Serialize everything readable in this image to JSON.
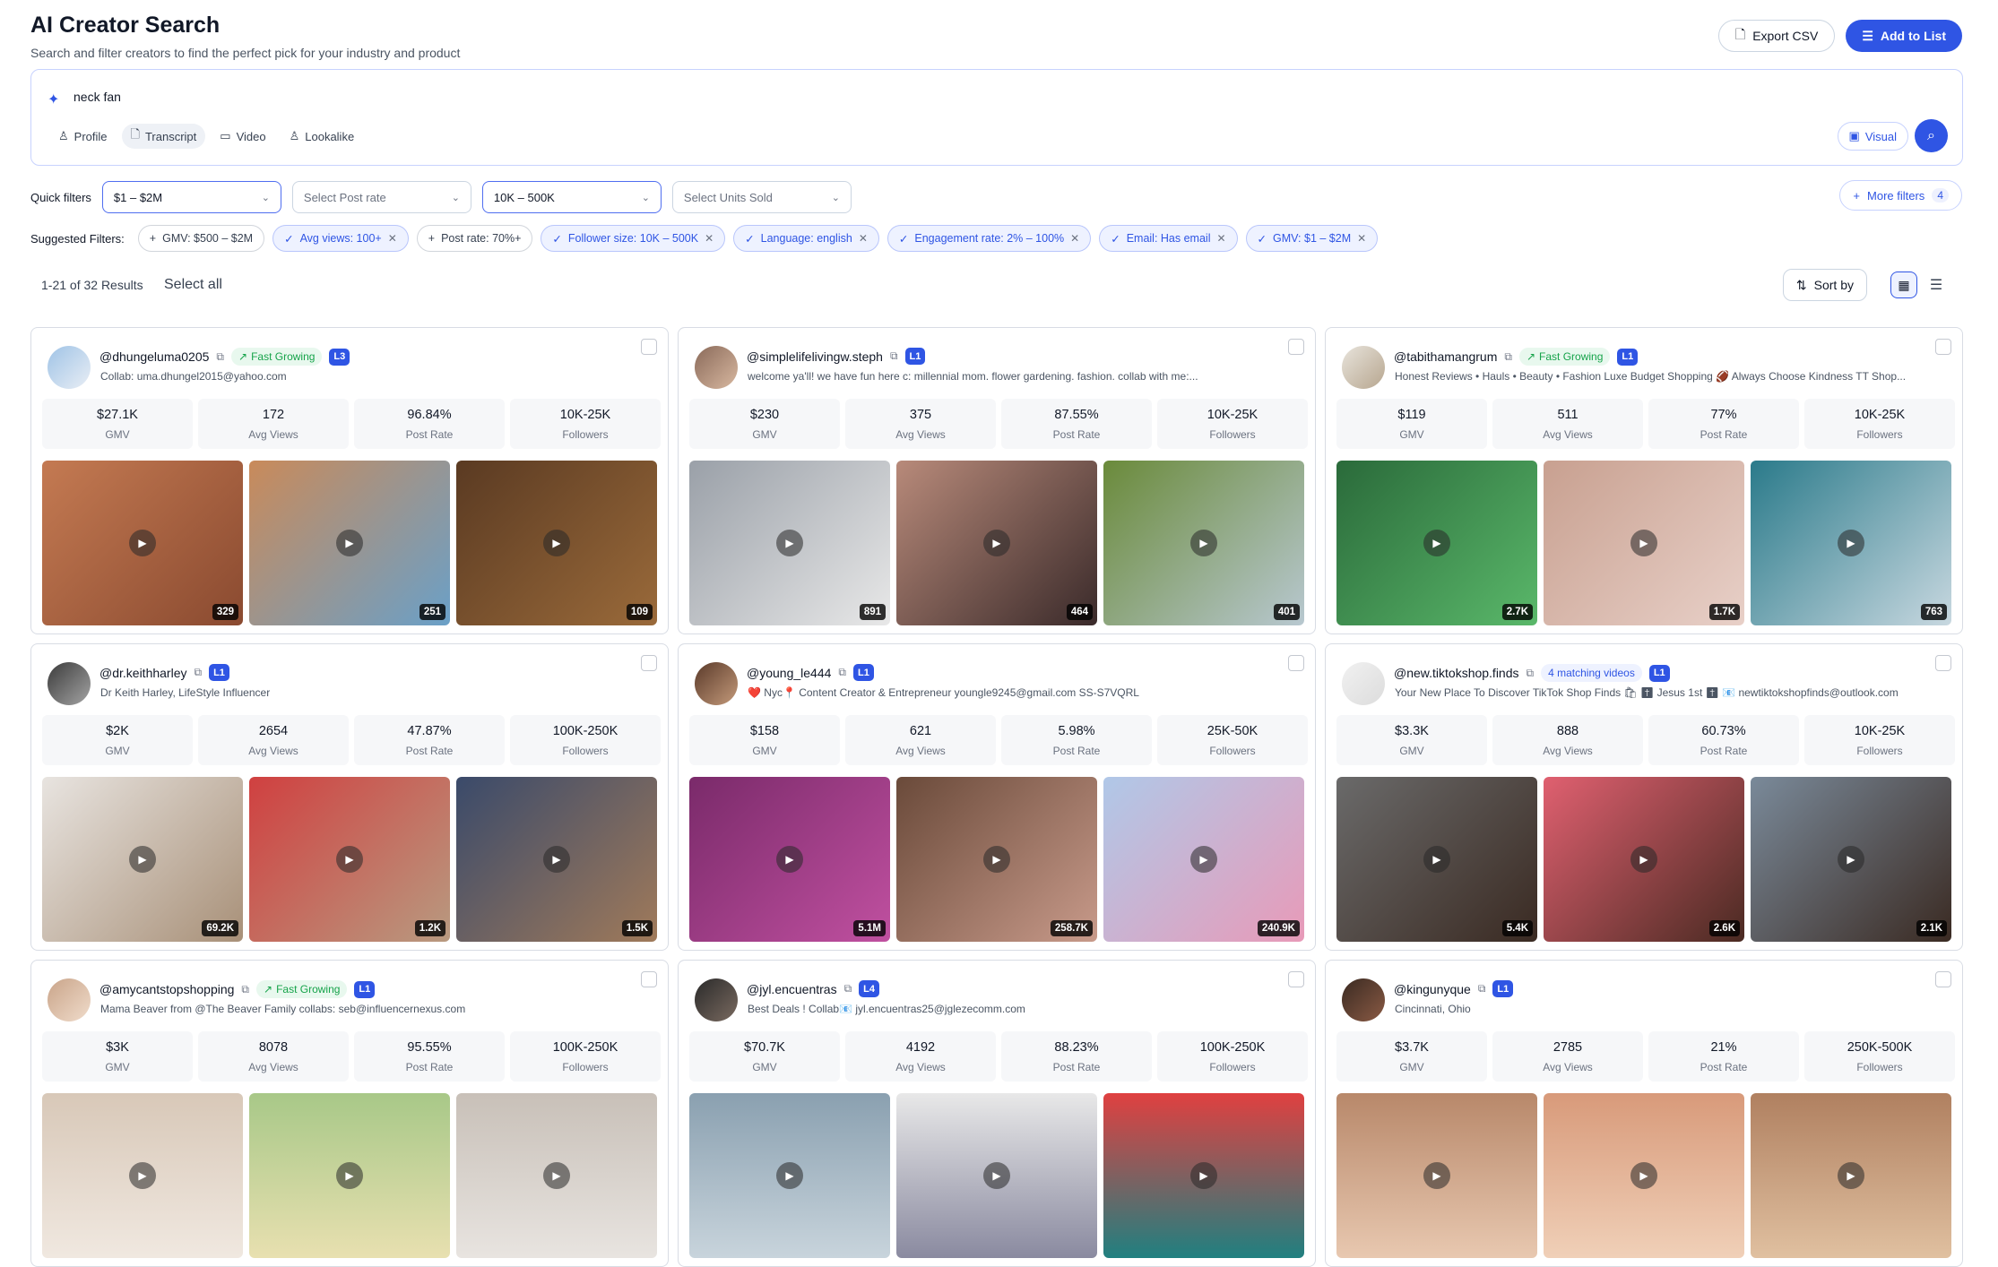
{
  "header": {
    "title": "AI Creator Search",
    "subtitle": "Search and filter creators to find the perfect pick for your industry and product",
    "export_label": "Export CSV",
    "add_label": "Add to List"
  },
  "search": {
    "query": "neck fan",
    "tabs": [
      "Profile",
      "Transcript",
      "Video",
      "Lookalike"
    ],
    "active_tab": "Transcript",
    "visual_label": "Visual"
  },
  "quick_filters": {
    "label": "Quick filters",
    "selects": [
      "$1 – $2M",
      "Select Post rate",
      "10K – 500K",
      "Select Units Sold"
    ],
    "more_label": "More filters",
    "more_count": "4"
  },
  "suggested": {
    "label": "Suggested Filters:",
    "chips": [
      "GMV: $500 – $2M",
      "Avg views: 100+",
      "Post rate: 70%+",
      "Follower size: 10K – 500K",
      "Language: english",
      "Engagement rate: 2% – 100%",
      "Email: Has email",
      "GMV: $1 – $2M"
    ]
  },
  "results": {
    "count_text": "1-21 of 32 Results",
    "select_all": "Select all",
    "sort_label": "Sort by"
  },
  "stat_labels": {
    "gmv": "GMV",
    "views": "Avg Views",
    "post": "Post Rate",
    "followers": "Followers"
  },
  "creators": [
    {
      "handle": "@dhungeluma0205",
      "badge": "Fast Growing",
      "level": "L3",
      "bio": "Collab: uma.dhungel2015@yahoo.com",
      "gmv": "$27.1K",
      "views": "172",
      "post": "96.84%",
      "followers": "10K-25K",
      "videos": [
        "329",
        "251",
        "109"
      ]
    },
    {
      "handle": "@simplelifelivingw.steph",
      "badge": "",
      "level": "L1",
      "bio": "welcome ya'll! we have fun here c: millennial mom. flower gardening. fashion. collab with me:...",
      "gmv": "$230",
      "views": "375",
      "post": "87.55%",
      "followers": "10K-25K",
      "videos": [
        "891",
        "464",
        "401"
      ]
    },
    {
      "handle": "@tabithamangrum",
      "badge": "Fast Growing",
      "level": "L1",
      "bio": "Honest Reviews • Hauls • Beauty • Fashion Luxe Budget Shopping 🏈 Always Choose Kindness TT Shop...",
      "gmv": "$119",
      "views": "511",
      "post": "77%",
      "followers": "10K-25K",
      "videos": [
        "2.7K",
        "1.7K",
        "763"
      ]
    },
    {
      "handle": "@dr.keithharley",
      "badge": "",
      "level": "L1",
      "bio": "Dr Keith Harley, LifeStyle Influencer",
      "gmv": "$2K",
      "views": "2654",
      "post": "47.87%",
      "followers": "100K-250K",
      "videos": [
        "69.2K",
        "1.2K",
        "1.5K"
      ]
    },
    {
      "handle": "@young_le444",
      "badge": "",
      "level": "L1",
      "bio": "❤️ Nyc📍 Content Creator & Entrepreneur youngle9245@gmail.com SS-S7VQRL",
      "gmv": "$158",
      "views": "621",
      "post": "5.98%",
      "followers": "25K-50K",
      "videos": [
        "5.1M",
        "258.7K",
        "240.9K"
      ]
    },
    {
      "handle": "@new.tiktokshop.finds",
      "badge": "4 matching videos",
      "level": "L1",
      "bio": "Your New Place To Discover TikTok Shop Finds 🛍 ✝ Jesus 1st ✝ 📧 newtiktokshopfinds@outlook.com",
      "gmv": "$3.3K",
      "views": "888",
      "post": "60.73%",
      "followers": "10K-25K",
      "videos": [
        "5.4K",
        "2.6K",
        "2.1K"
      ]
    },
    {
      "handle": "@amycantstopshopping",
      "badge": "Fast Growing",
      "level": "L1",
      "bio": "Mama Beaver from @The Beaver Family collabs: seb@influencernexus.com",
      "gmv": "$3K",
      "views": "8078",
      "post": "95.55%",
      "followers": "100K-250K",
      "videos": [
        "",
        "",
        ""
      ]
    },
    {
      "handle": "@jyl.encuentras",
      "badge": "",
      "level": "L4",
      "bio": "Best Deals ! Collab📧 jyl.encuentras25@jglezecomm.com",
      "gmv": "$70.7K",
      "views": "4192",
      "post": "88.23%",
      "followers": "100K-250K",
      "videos": [
        "",
        "",
        ""
      ]
    },
    {
      "handle": "@kingunyque",
      "badge": "",
      "level": "L1",
      "bio": "Cincinnati, Ohio",
      "gmv": "$3.7K",
      "views": "2785",
      "post": "21%",
      "followers": "250K-500K",
      "videos": [
        "",
        "",
        ""
      ]
    }
  ],
  "icons": {
    "export": "file-icon",
    "add": "list-add-icon",
    "search": "search-icon",
    "sparkle": "sparkle-icon",
    "copy": "copy-icon",
    "play": "play-icon"
  }
}
